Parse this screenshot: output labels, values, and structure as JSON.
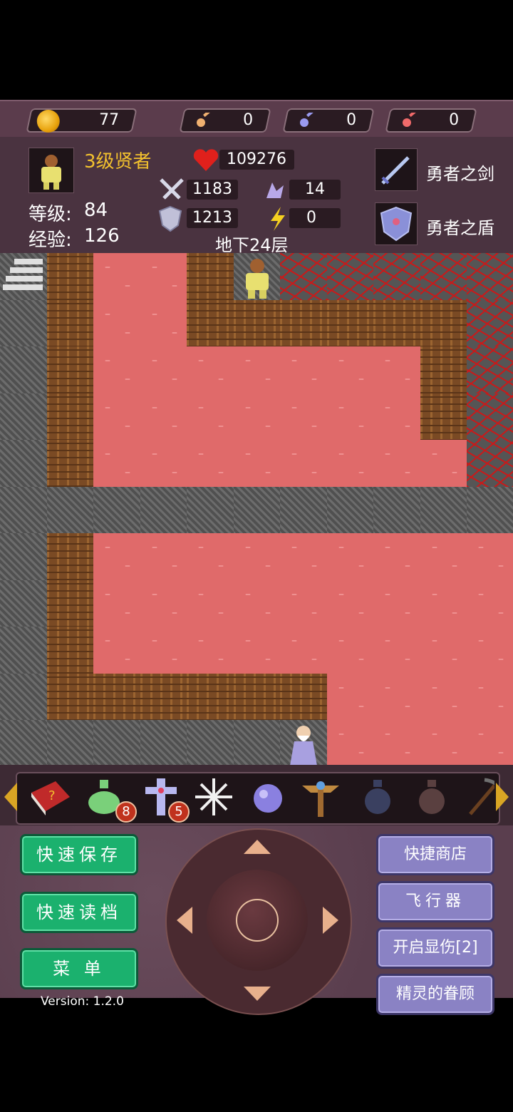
{
  "resources": {
    "gold": "77",
    "yellow_key": "0",
    "blue_key": "0",
    "red_key": "0"
  },
  "hero": {
    "title": "3级贤者",
    "level_label": "等级:",
    "level": "84",
    "exp_label": "经验:",
    "exp": "126",
    "hp": "109276",
    "attack": "1183",
    "defense": "1213",
    "magic_def": "14",
    "energy": "0"
  },
  "floor_label": "地下24层",
  "equipment": {
    "weapon": "勇者之剑",
    "shield": "勇者之盾"
  },
  "items": {
    "potion_count": "8",
    "cross_count": "5"
  },
  "buttons": {
    "quick_save": "快速保存",
    "quick_load": "快速读档",
    "menu": "菜 单",
    "quick_shop": "快捷商店",
    "flyer": "飞行器",
    "show_damage": "开启显伤[2]",
    "spirit_favor": "精灵的眷顾"
  },
  "version": "Version: 1.2.0",
  "colors": {
    "title_gold": "#f2c12e",
    "lava": "#e06a6a",
    "green_button": "#1bb16e",
    "purple_button": "#8a82c4"
  }
}
